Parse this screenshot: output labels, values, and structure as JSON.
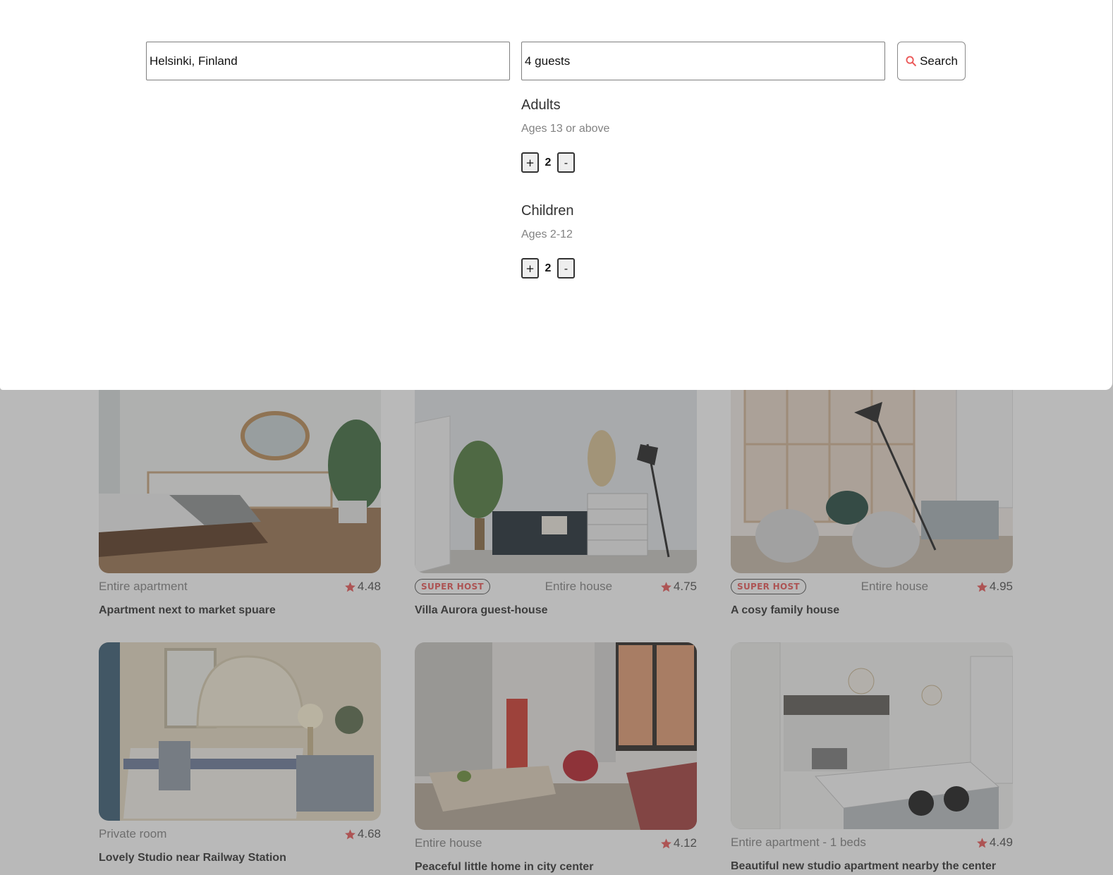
{
  "search": {
    "location_value": "Helsinki, Finland",
    "guests_value": "4 guests",
    "button_label": "Search"
  },
  "guests_panel": {
    "adults": {
      "title": "Adults",
      "subtitle": "Ages 13 or above",
      "count": "2",
      "plus": "+",
      "minus": "-"
    },
    "children": {
      "title": "Children",
      "subtitle": "Ages 2-12",
      "count": "2",
      "plus": "+",
      "minus": "-"
    }
  },
  "listings": [
    {
      "super_host": "",
      "type": "Entire apartment",
      "rating": "4.48",
      "title": "Apartment next to market spuare"
    },
    {
      "super_host": "SUPER HOST",
      "type": "Entire house",
      "rating": "4.75",
      "title": "Villa Aurora guest-house"
    },
    {
      "super_host": "SUPER HOST",
      "type": "Entire house",
      "rating": "4.95",
      "title": "A cosy family house"
    },
    {
      "super_host": "",
      "type": "Private room",
      "rating": "4.68",
      "title": "Lovely Studio near Railway Station"
    },
    {
      "super_host": "",
      "type": "Entire house",
      "rating": "4.12",
      "title": "Peaceful little home in city center"
    },
    {
      "super_host": "",
      "type": "Entire apartment - 1 beds",
      "rating": "4.49",
      "title": "Beautiful new studio apartment nearby the center"
    }
  ],
  "colors": {
    "accent": "#eb5757",
    "overlay": "rgba(79,79,79,0.40)",
    "muted_text": "#828282"
  },
  "icons": {
    "search": "search-icon",
    "star": "star-icon"
  }
}
